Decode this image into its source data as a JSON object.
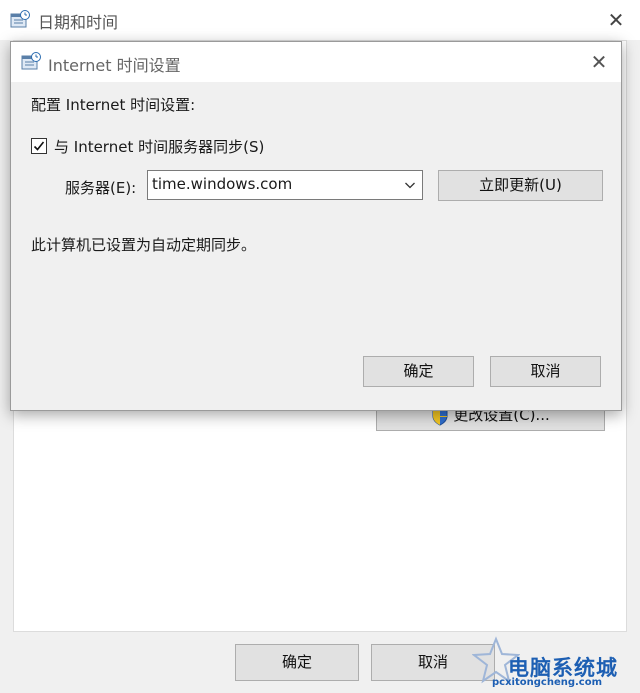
{
  "parent_window": {
    "title": "日期和时间",
    "change_settings_label": "更改设置(C)...",
    "ok_label": "确定",
    "cancel_label": "取消"
  },
  "dialog": {
    "title": "Internet 时间设置",
    "config_label": "配置 Internet 时间设置:",
    "sync_checkbox": {
      "label": "与 Internet 时间服务器同步(S)",
      "checked": true
    },
    "server_label": "服务器(E):",
    "server_value": "time.windows.com",
    "update_button_label": "立即更新(U)",
    "status_text": "此计算机已设置为自动定期同步。",
    "ok_label": "确定",
    "cancel_label": "取消"
  },
  "watermark": {
    "main": "电脑系统城",
    "sub": "pcxitongcheng.com"
  },
  "colors": {
    "watermark_blue": "#1d5fb3",
    "window_bg": "#f0f0f0",
    "button_bg": "#e1e1e1"
  },
  "icons": [
    "clock-calendar-icon",
    "close-icon",
    "uac-shield-icon",
    "checkmark-icon",
    "chevron-down-icon",
    "star-logo-icon"
  ]
}
